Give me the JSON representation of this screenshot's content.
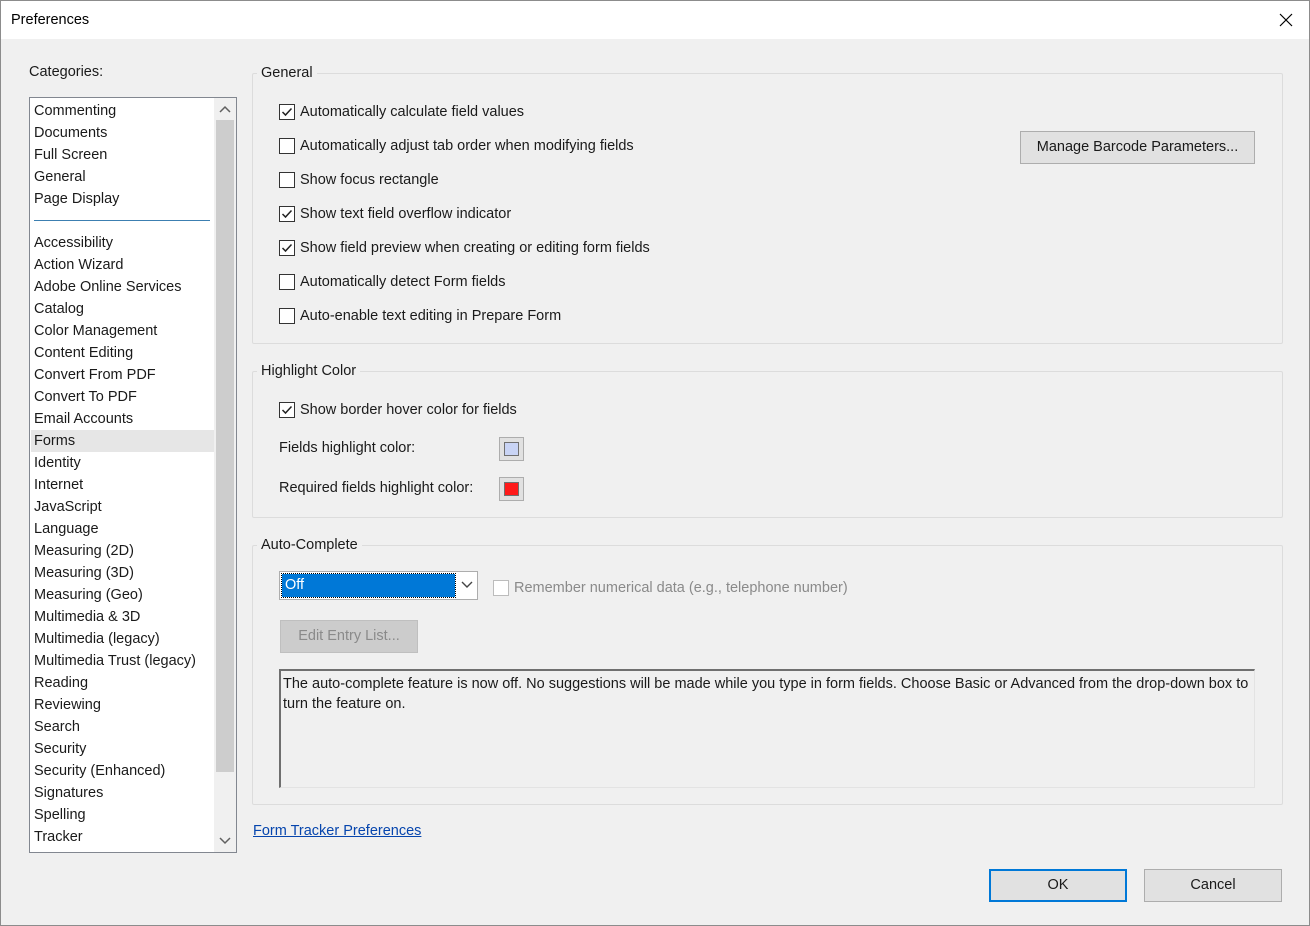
{
  "window": {
    "title": "Preferences"
  },
  "categories": {
    "label": "Categories:",
    "pinned": [
      "Commenting",
      "Documents",
      "Full Screen",
      "General",
      "Page Display"
    ],
    "items": [
      "Accessibility",
      "Action Wizard",
      "Adobe Online Services",
      "Catalog",
      "Color Management",
      "Content Editing",
      "Convert From PDF",
      "Convert To PDF",
      "Email Accounts",
      "Forms",
      "Identity",
      "Internet",
      "JavaScript",
      "Language",
      "Measuring (2D)",
      "Measuring (3D)",
      "Measuring (Geo)",
      "Multimedia & 3D",
      "Multimedia (legacy)",
      "Multimedia Trust (legacy)",
      "Reading",
      "Reviewing",
      "Search",
      "Security",
      "Security (Enhanced)",
      "Signatures",
      "Spelling",
      "Tracker"
    ],
    "selected": "Forms"
  },
  "general": {
    "title": "General",
    "options": [
      {
        "label": "Automatically calculate field values",
        "checked": true
      },
      {
        "label": "Automatically adjust tab order when modifying fields",
        "checked": false
      },
      {
        "label": "Show focus rectangle",
        "checked": false
      },
      {
        "label": "Show text field overflow indicator",
        "checked": true
      },
      {
        "label": "Show field preview when creating or editing form fields",
        "checked": true
      },
      {
        "label": "Automatically detect Form fields",
        "checked": false
      },
      {
        "label": "Auto-enable text editing in Prepare Form",
        "checked": false
      }
    ],
    "barcode_button": "Manage Barcode Parameters..."
  },
  "highlight": {
    "title": "Highlight Color",
    "hover_option": {
      "label": "Show border hover color for fields",
      "checked": true
    },
    "fields_label": "Fields highlight color:",
    "fields_color": "#c9d4f5",
    "required_label": "Required fields highlight color:",
    "required_color": "#ff1a1a"
  },
  "autocomplete": {
    "title": "Auto-Complete",
    "mode": "Off",
    "remember_label": "Remember numerical data (e.g., telephone number)",
    "remember_checked": false,
    "edit_button": "Edit Entry List...",
    "description": "The auto-complete feature is now off. No suggestions will be made while you type in form fields. Choose Basic or Advanced from the drop-down box to turn the feature on."
  },
  "tracker_link": "Form Tracker Preferences",
  "buttons": {
    "ok": "OK",
    "cancel": "Cancel"
  }
}
